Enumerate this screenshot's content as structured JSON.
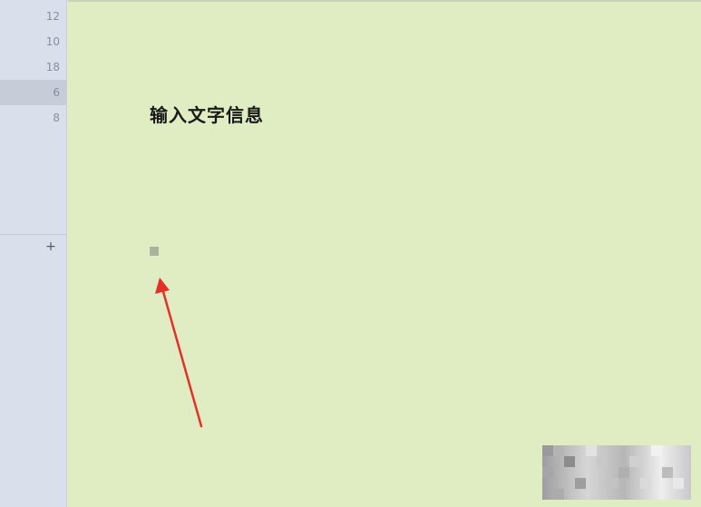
{
  "sidebar": {
    "items": [
      {
        "label": "12",
        "selected": false
      },
      {
        "label": "10",
        "selected": false
      },
      {
        "label": "18",
        "selected": false
      },
      {
        "label": "6",
        "selected": true
      },
      {
        "label": "8",
        "selected": false
      }
    ],
    "add_label": "+"
  },
  "canvas": {
    "text": "输入文字信息",
    "background_color": "#e0edc2"
  },
  "annotation": {
    "arrow_color": "#e5302a"
  }
}
